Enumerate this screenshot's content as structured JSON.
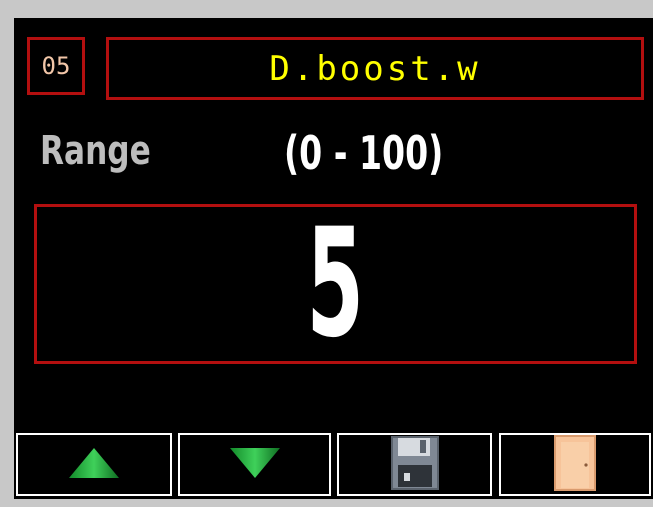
{
  "header": {
    "index": "05",
    "parameter_name": "D.boost.w"
  },
  "range": {
    "label": "Range",
    "value": "(0 - 100)"
  },
  "current_value": "5",
  "toolbar": {
    "buttons": [
      {
        "name": "increase",
        "icon": "up-triangle-icon"
      },
      {
        "name": "decrease",
        "icon": "down-triangle-icon"
      },
      {
        "name": "save",
        "icon": "floppy-disk-icon"
      },
      {
        "name": "exit",
        "icon": "door-icon"
      }
    ]
  },
  "colors": {
    "background": "#000000",
    "frame": "#c8c8c8",
    "border_red": "#b30f0f",
    "name_text": "#ffff00",
    "index_text": "#f2c6a8",
    "label_text": "#bdbdbd",
    "value_text": "#ffffff",
    "arrow_green": "#22a83a",
    "door": "#f7c49a"
  }
}
